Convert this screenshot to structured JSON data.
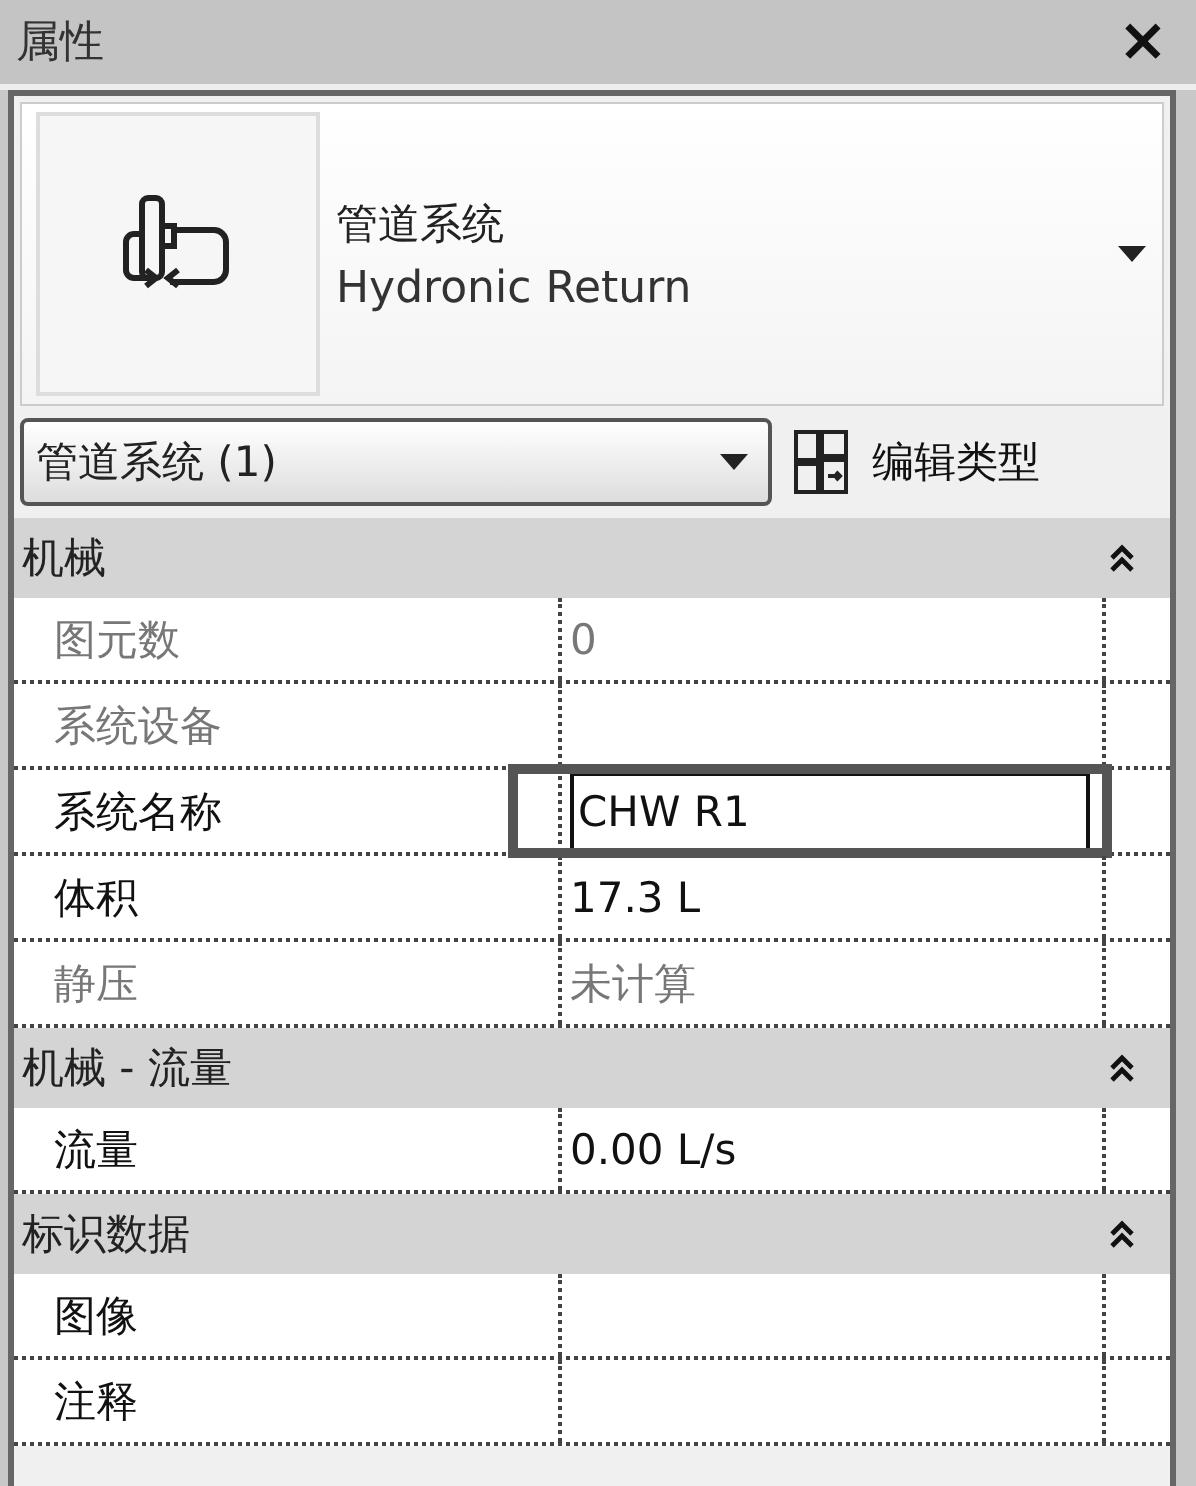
{
  "window": {
    "title": "属性",
    "close": "×"
  },
  "type_selector": {
    "category": "管道系统",
    "type": "Hydronic Return"
  },
  "instance_filter": {
    "value": "管道系统 (1)"
  },
  "edit_type_button": {
    "label": "编辑类型"
  },
  "sections": [
    {
      "title": "机械",
      "expanded": true,
      "rows": [
        {
          "label": "图元数",
          "value": "0",
          "disabled": true,
          "selected": false
        },
        {
          "label": "系统设备",
          "value": "",
          "disabled": true,
          "selected": false
        },
        {
          "label": "系统名称",
          "value": "CHW R1",
          "disabled": false,
          "selected": true
        },
        {
          "label": "体积",
          "value": "17.3 L",
          "disabled": false,
          "selected": false
        },
        {
          "label": "静压",
          "value": "未计算",
          "disabled": true,
          "selected": false
        }
      ]
    },
    {
      "title": "机械 - 流量",
      "expanded": true,
      "rows": [
        {
          "label": "流量",
          "value": "0.00 L/s",
          "disabled": false,
          "selected": false
        }
      ]
    },
    {
      "title": "标识数据",
      "expanded": true,
      "rows": [
        {
          "label": "图像",
          "value": "",
          "disabled": false,
          "selected": false
        },
        {
          "label": "注释",
          "value": "",
          "disabled": false,
          "selected": false
        }
      ]
    }
  ]
}
